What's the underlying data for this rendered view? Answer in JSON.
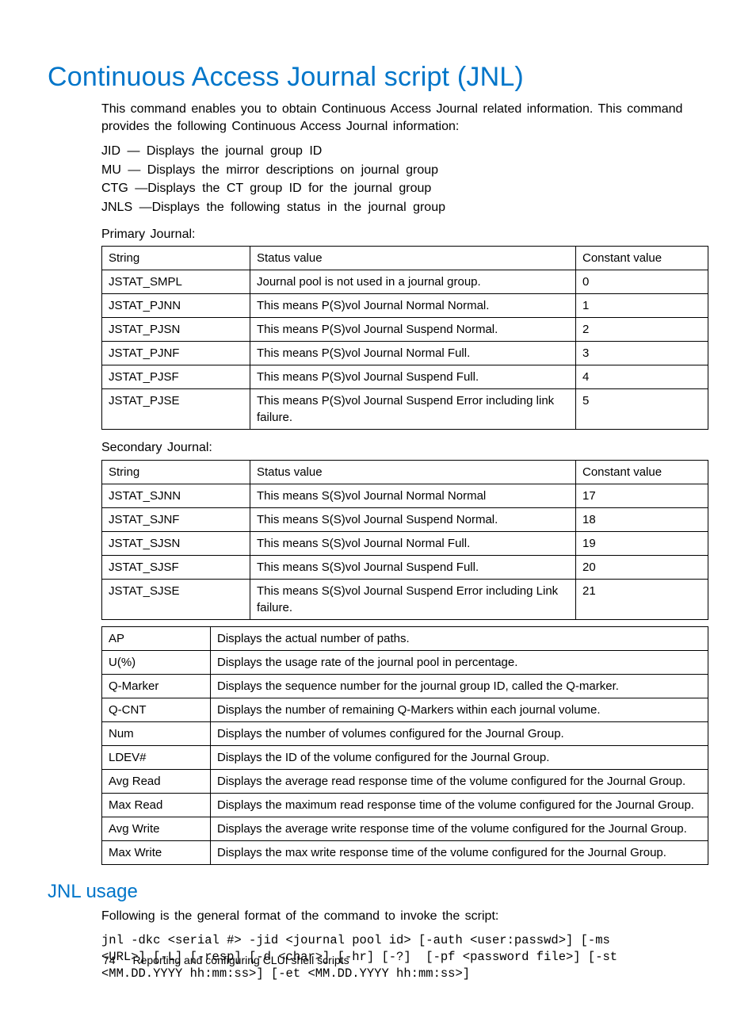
{
  "title": "Continuous Access Journal script (JNL)",
  "intro": "This command enables you to obtain Continuous Access Journal related information. This command provides the following Continuous Access Journal information:",
  "definitions": [
    "JID — Displays the journal group ID",
    "MU — Displays the mirror descriptions on journal group",
    "CTG —Displays the CT group ID for the journal group",
    "JNLS —Displays the following status in the journal group"
  ],
  "primary_label": "Primary Journal:",
  "table1": {
    "headers": [
      "String",
      "Status value",
      "Constant value"
    ],
    "rows": [
      [
        "JSTAT_SMPL",
        "Journal pool is not used in a journal group.",
        "0"
      ],
      [
        "JSTAT_PJNN",
        "This means P(S)vol Journal Normal Normal.",
        "1"
      ],
      [
        "JSTAT_PJSN",
        "This means P(S)vol Journal Suspend Normal.",
        "2"
      ],
      [
        "JSTAT_PJNF",
        "This means P(S)vol Journal Normal Full.",
        "3"
      ],
      [
        "JSTAT_PJSF",
        "This means P(S)vol Journal Suspend Full.",
        "4"
      ],
      [
        "JSTAT_PJSE",
        "This means P(S)vol Journal Suspend Error including link failure.",
        "5"
      ]
    ]
  },
  "secondary_label": "Secondary Journal:",
  "table2": {
    "headers": [
      "String",
      "Status value",
      "Constant value"
    ],
    "rows": [
      [
        "JSTAT_SJNN",
        "This means S(S)vol Journal Normal Normal",
        "17"
      ],
      [
        "JSTAT_SJNF",
        "This means S(S)vol Journal Suspend Normal.",
        "18"
      ],
      [
        "JSTAT_SJSN",
        "This means S(S)vol Journal Normal Full.",
        "19"
      ],
      [
        "JSTAT_SJSF",
        "This means S(S)vol Journal Suspend Full.",
        "20"
      ],
      [
        "JSTAT_SJSE",
        "This means S(S)vol Journal Suspend Error including Link failure.",
        "21"
      ]
    ]
  },
  "table3": {
    "rows": [
      [
        "AP",
        "Displays the actual number of paths."
      ],
      [
        "U(%)",
        "Displays the usage rate of the journal pool in percentage."
      ],
      [
        "Q-Marker",
        "Displays the sequence number for the journal group ID, called the Q-marker."
      ],
      [
        "Q-CNT",
        "Displays the number of remaining Q-Markers within each journal volume."
      ],
      [
        "Num",
        "Displays the number of volumes configured for the Journal Group."
      ],
      [
        "LDEV#",
        "Displays the ID of the volume configured for the Journal Group."
      ],
      [
        "Avg Read",
        "Displays the average read response time of the volume configured for the Journal Group."
      ],
      [
        "Max Read",
        "Displays the maximum read response time of the volume configured for the Journal Group."
      ],
      [
        "Avg Write",
        "Displays the average write response time of the volume configured for the Journal Group."
      ],
      [
        "Max Write",
        "Displays the max write response time of the volume configured for the Journal Group."
      ]
    ]
  },
  "usage_heading": "JNL usage",
  "usage_intro": "Following is the general format of the command to invoke the script:",
  "usage_code": "jnl -dkc <serial #> -jid <journal pool id> [-auth <user:passwd>] [-ms\n<URL>] [-L] [-resp] [-d <char>] [-hr] [-?]  [-pf <password file>] [-st\n<MM.DD.YYYY hh:mm:ss>] [-et <MM.DD.YYYY hh:mm:ss>]",
  "footer": {
    "page": "74",
    "section": "Reporting and configuring CLUI shell scripts"
  }
}
